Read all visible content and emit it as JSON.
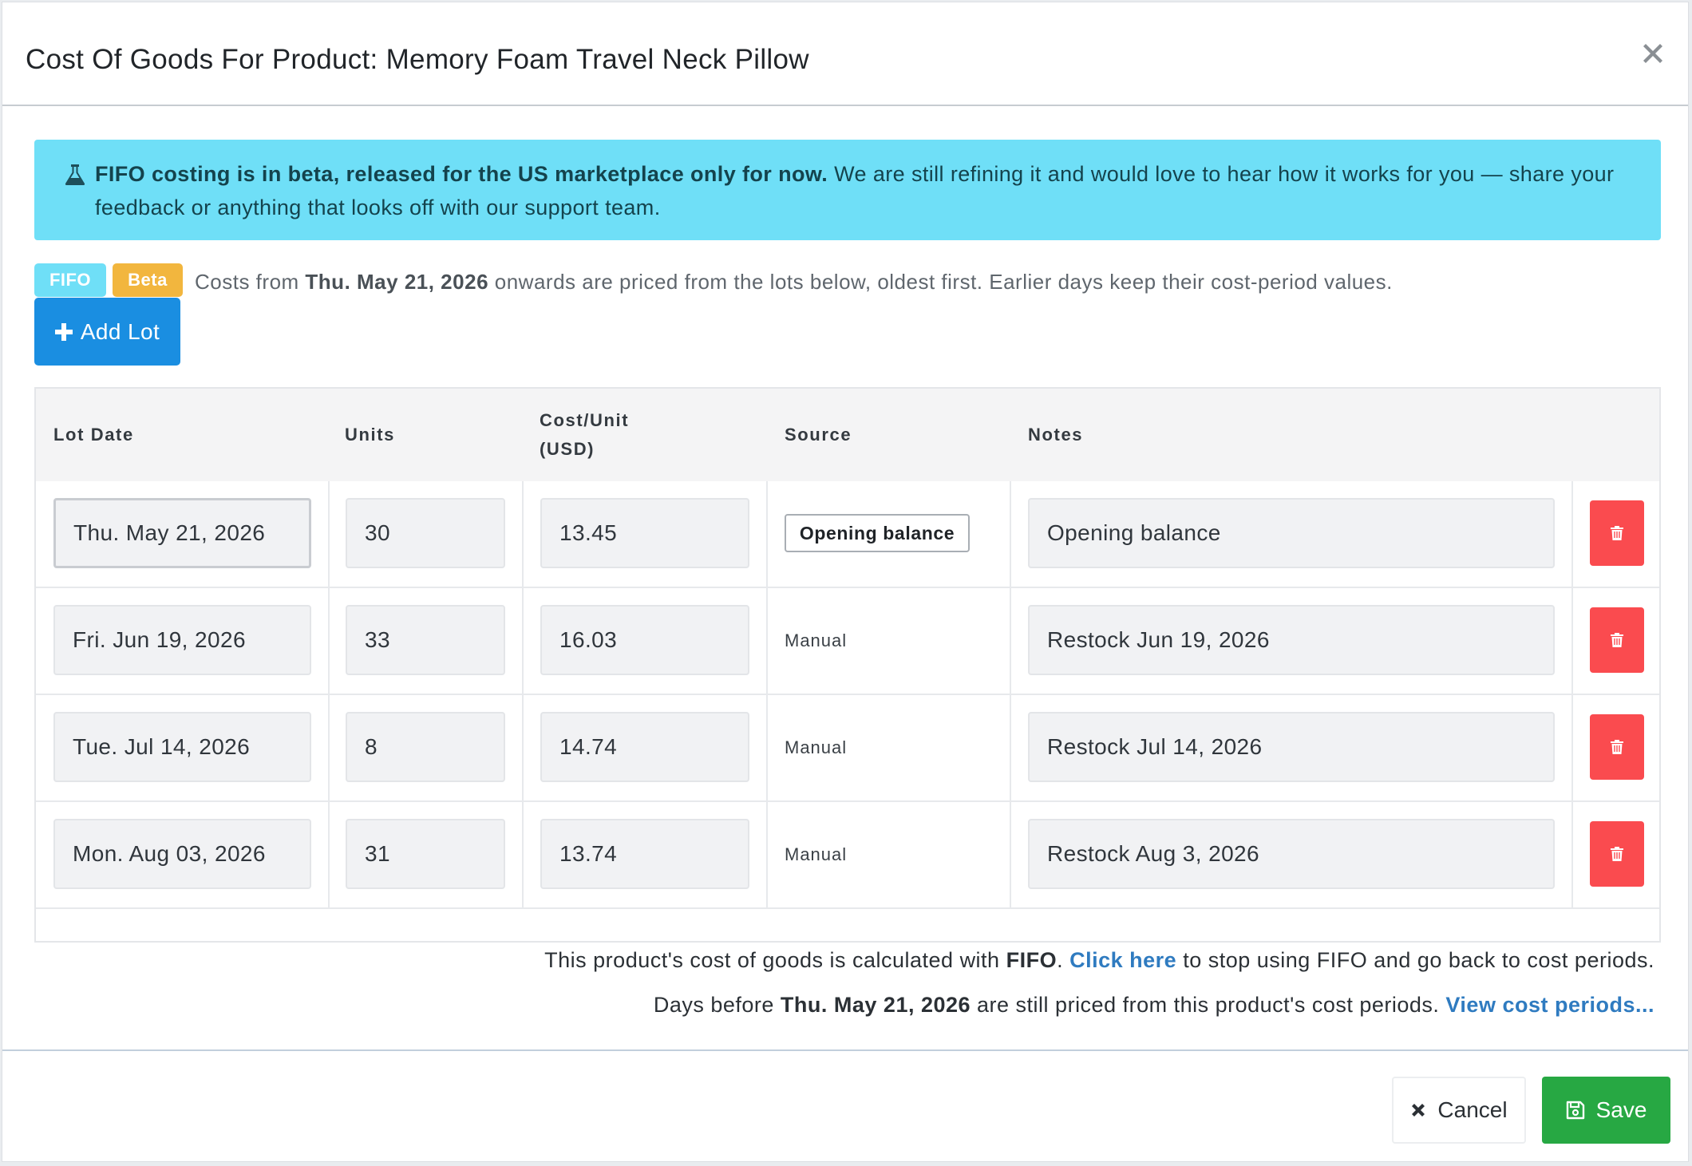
{
  "modal": {
    "title": "Cost Of Goods For Product: Memory Foam Travel Neck Pillow",
    "close_icon": "close-icon"
  },
  "alert": {
    "icon": "flask-icon",
    "bold_text": "FIFO costing is in beta, released for the US marketplace only for now.",
    "text": " We are still refining it and would love to hear how it works for you — share your feedback or anything that looks off with our support team.",
    "color": "#6fdff7"
  },
  "badges": {
    "fifo": "FIFO",
    "beta": "Beta"
  },
  "info": {
    "prefix": "Costs from ",
    "date": "Thu. May 21, 2026",
    "suffix": " onwards are priced from the lots below, oldest first. Earlier days keep their cost-period values."
  },
  "add_lot": {
    "label": "Add Lot",
    "icon": "plus-icon"
  },
  "table": {
    "headers": {
      "lot_date": "Lot Date",
      "units": "Units",
      "cost_unit_line1": "Cost/Unit",
      "cost_unit_line2": "(USD)",
      "source": "Source",
      "notes": "Notes"
    },
    "rows": [
      {
        "lot_date": "Thu. May 21, 2026",
        "units": "30",
        "cost": "13.45",
        "source": "Opening balance",
        "notes": "Opening balance"
      },
      {
        "lot_date": "Fri. Jun 19, 2026",
        "units": "33",
        "cost": "16.03",
        "source": "Manual",
        "notes": "Restock Jun 19, 2026"
      },
      {
        "lot_date": "Tue. Jul 14, 2026",
        "units": "8",
        "cost": "14.74",
        "source": "Manual",
        "notes": "Restock Jul 14, 2026"
      },
      {
        "lot_date": "Mon. Aug 03, 2026",
        "units": "31",
        "cost": "13.74",
        "source": "Manual",
        "notes": "Restock Aug 3, 2026"
      }
    ],
    "delete_icon": "trash-icon"
  },
  "footer_info": {
    "line1_prefix": "This product's cost of goods is calculated with ",
    "line1_method": "FIFO",
    "line1_mid": ". ",
    "line1_link": "Click here",
    "line1_suffix": " to stop using FIFO and go back to cost periods.",
    "line2_prefix": "Days before ",
    "line2_date": "Thu. May 21, 2026",
    "line2_mid": " are still priced from this product's cost periods. ",
    "line2_link": "View cost periods..."
  },
  "buttons": {
    "cancel": "Cancel",
    "cancel_icon": "times-icon",
    "save": "Save",
    "save_icon": "floppy-disk-icon"
  },
  "colors": {
    "primary": "#1a8ee1",
    "danger": "#fa4b4f",
    "success": "#27a843",
    "beta": "#f2b63e",
    "link": "#2f7bc0"
  }
}
